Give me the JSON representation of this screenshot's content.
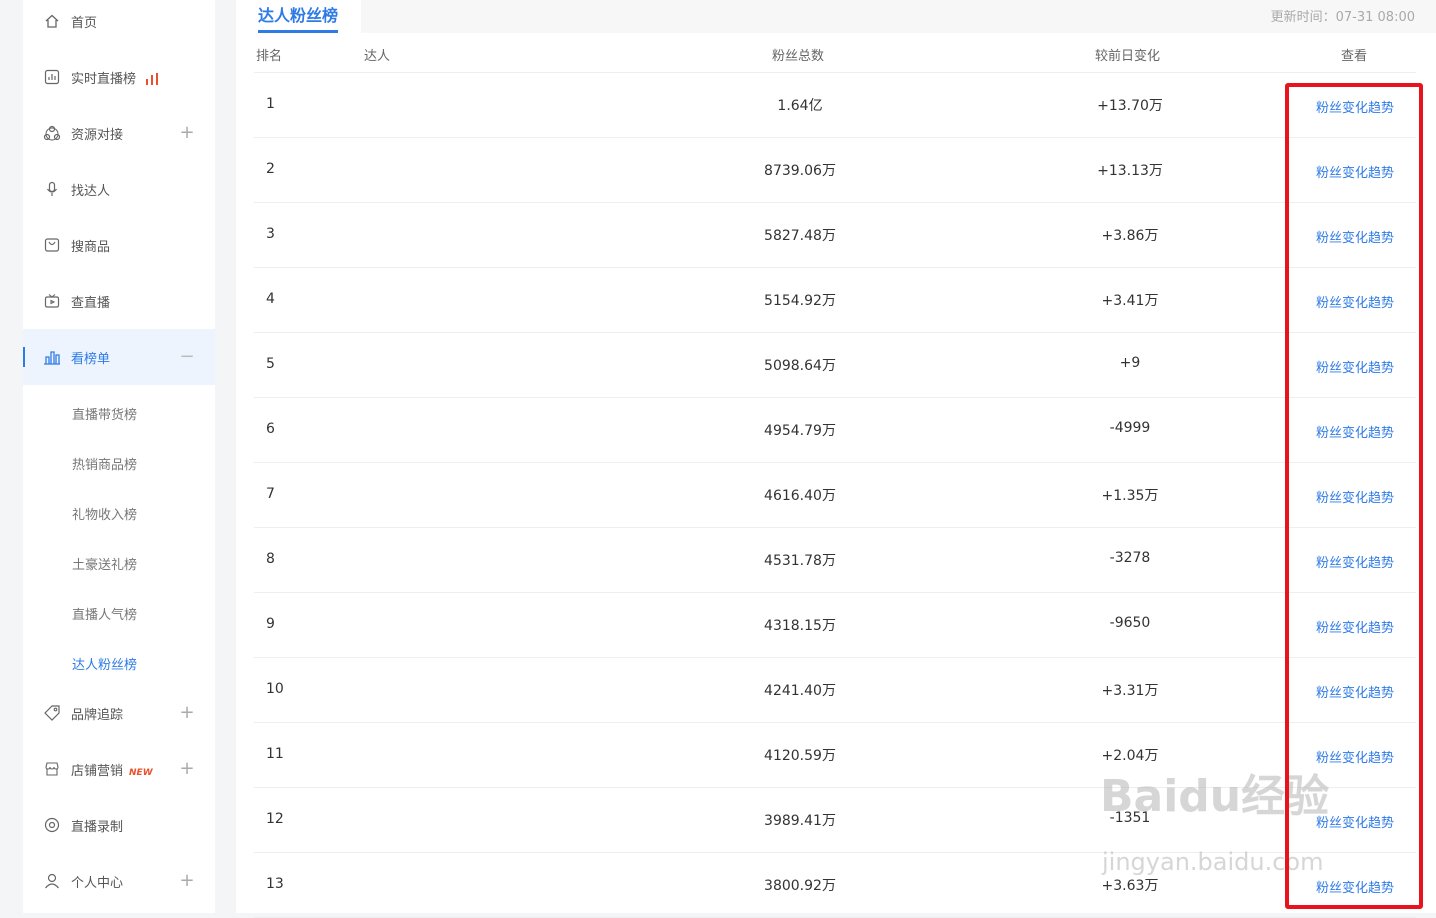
{
  "sidebar": {
    "items": [
      {
        "label": "首页",
        "icon": "home-icon"
      },
      {
        "label": "实时直播榜",
        "icon": "live-chart-icon"
      },
      {
        "label": "资源对接",
        "icon": "resource-icon"
      },
      {
        "label": "找达人",
        "icon": "mic-icon"
      },
      {
        "label": "搜商品",
        "icon": "bag-icon"
      },
      {
        "label": "查直播",
        "icon": "tv-icon"
      },
      {
        "label": "看榜单",
        "icon": "bar-chart-icon"
      },
      {
        "label": "品牌追踪",
        "icon": "tag-icon"
      },
      {
        "label": "店铺营销",
        "icon": "shop-icon",
        "badge": "NEW"
      },
      {
        "label": "直播录制",
        "icon": "record-icon"
      },
      {
        "label": "个人中心",
        "icon": "user-icon"
      }
    ],
    "sub_items": [
      "直播带货榜",
      "热销商品榜",
      "礼物收入榜",
      "土豪送礼榜",
      "直播人气榜",
      "达人粉丝榜"
    ]
  },
  "header": {
    "tab": "达人粉丝榜",
    "update_time": "更新时间：07-31 08:00"
  },
  "table": {
    "columns": [
      "排名",
      "达人",
      "粉丝总数",
      "较前日变化",
      "查看"
    ],
    "rows": [
      {
        "rank": "1",
        "fans": "1.64亿",
        "change": "+13.70万",
        "view": "粉丝变化趋势"
      },
      {
        "rank": "2",
        "fans": "8739.06万",
        "change": "+13.13万",
        "view": "粉丝变化趋势"
      },
      {
        "rank": "3",
        "fans": "5827.48万",
        "change": "+3.86万",
        "view": "粉丝变化趋势"
      },
      {
        "rank": "4",
        "fans": "5154.92万",
        "change": "+3.41万",
        "view": "粉丝变化趋势"
      },
      {
        "rank": "5",
        "fans": "5098.64万",
        "change": "+9",
        "view": "粉丝变化趋势"
      },
      {
        "rank": "6",
        "fans": "4954.79万",
        "change": "-4999",
        "view": "粉丝变化趋势"
      },
      {
        "rank": "7",
        "fans": "4616.40万",
        "change": "+1.35万",
        "view": "粉丝变化趋势"
      },
      {
        "rank": "8",
        "fans": "4531.78万",
        "change": "-3278",
        "view": "粉丝变化趋势"
      },
      {
        "rank": "9",
        "fans": "4318.15万",
        "change": "-9650",
        "view": "粉丝变化趋势"
      },
      {
        "rank": "10",
        "fans": "4241.40万",
        "change": "+3.31万",
        "view": "粉丝变化趋势"
      },
      {
        "rank": "11",
        "fans": "4120.59万",
        "change": "+2.04万",
        "view": "粉丝变化趋势"
      },
      {
        "rank": "12",
        "fans": "3989.41万",
        "change": "-1351",
        "view": "粉丝变化趋势"
      },
      {
        "rank": "13",
        "fans": "3800.92万",
        "change": "+3.63万",
        "view": "粉丝变化趋势"
      }
    ]
  },
  "watermark": {
    "line1": "Baidu经验",
    "line2": "jingyan.baidu.com"
  },
  "colors": {
    "accent": "#2f7be6",
    "highlight": "#e8131c",
    "badge": "#e8512a"
  }
}
